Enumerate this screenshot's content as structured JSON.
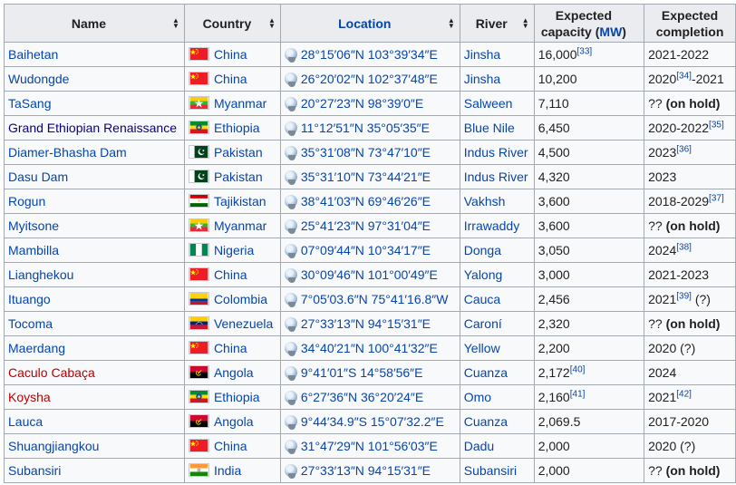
{
  "header": {
    "name": "Name",
    "country": "Country",
    "location": "Location",
    "river": "River",
    "capacity_pre": "Expected capacity (",
    "capacity_unit": "MW",
    "capacity_post": ")",
    "completion": "Expected completion"
  },
  "rows": [
    {
      "name": "Baihetan",
      "name_style": "link",
      "flag": "china",
      "country": "China",
      "coord": "28°15′06″N 103°39′34″E",
      "river": "Jinsha",
      "capacity": "16,000",
      "capacity_ref": "[33]",
      "completion": "2021-2022",
      "completion_ref": "",
      "completion_tail": "",
      "completion_bold": ""
    },
    {
      "name": "Wudongde",
      "name_style": "link",
      "flag": "china",
      "country": "China",
      "coord": "26°20′02″N 102°37′48″E",
      "river": "Jinsha",
      "capacity": "10,200",
      "capacity_ref": "",
      "completion": "2020",
      "completion_ref": "[34]",
      "completion_tail": "-2021",
      "completion_bold": ""
    },
    {
      "name": "TaSang",
      "name_style": "link",
      "flag": "myanmar",
      "country": "Myanmar",
      "coord": "20°27′23″N 98°39′0″E",
      "river": "Salween",
      "capacity": "7,110",
      "capacity_ref": "",
      "completion": "?? ",
      "completion_ref": "",
      "completion_tail": "",
      "completion_bold": "(on hold)"
    },
    {
      "name": "Grand Ethiopian Renaissance",
      "name_style": "dark",
      "flag": "ethiopia",
      "country": "Ethiopia",
      "coord": "11°12′51″N 35°05′35″E",
      "river": "Blue Nile",
      "capacity": "6,450",
      "capacity_ref": "",
      "completion": "2020-2022",
      "completion_ref": "[35]",
      "completion_tail": "",
      "completion_bold": ""
    },
    {
      "name": "Diamer-Bhasha Dam",
      "name_style": "link",
      "flag": "pakistan",
      "country": "Pakistan",
      "coord": "35°31′08″N 73°47′10″E",
      "river": "Indus River",
      "capacity": "4,500",
      "capacity_ref": "",
      "completion": "2023",
      "completion_ref": "[36]",
      "completion_tail": "",
      "completion_bold": ""
    },
    {
      "name": "Dasu Dam",
      "name_style": "link",
      "flag": "pakistan",
      "country": "Pakistan",
      "coord": "35°31′10″N 73°44′21″E",
      "river": "Indus River",
      "capacity": "4,320",
      "capacity_ref": "",
      "completion": "2023",
      "completion_ref": "",
      "completion_tail": "",
      "completion_bold": ""
    },
    {
      "name": "Rogun",
      "name_style": "link",
      "flag": "tajikistan",
      "country": "Tajikistan",
      "coord": "38°41′03″N 69°46′26″E",
      "river": "Vakhsh",
      "capacity": "3,600",
      "capacity_ref": "",
      "completion": "2018-2029",
      "completion_ref": "[37]",
      "completion_tail": "",
      "completion_bold": ""
    },
    {
      "name": "Myitsone",
      "name_style": "link",
      "flag": "myanmar",
      "country": "Myanmar",
      "coord": "25°41′23″N 97°31′04″E",
      "river": "Irrawaddy",
      "capacity": "3,600",
      "capacity_ref": "",
      "completion": "?? ",
      "completion_ref": "",
      "completion_tail": "",
      "completion_bold": "(on hold)"
    },
    {
      "name": "Mambilla",
      "name_style": "link",
      "flag": "nigeria",
      "country": "Nigeria",
      "coord": "07°09′44″N 10°34′17″E",
      "river": "Donga",
      "capacity": "3,050",
      "capacity_ref": "",
      "completion": "2024",
      "completion_ref": "[38]",
      "completion_tail": "",
      "completion_bold": ""
    },
    {
      "name": "Lianghekou",
      "name_style": "link",
      "flag": "china",
      "country": "China",
      "coord": "30°09′46″N 101°00′49″E",
      "river": "Yalong",
      "capacity": "3,000",
      "capacity_ref": "",
      "completion": "2021-2023",
      "completion_ref": "",
      "completion_tail": "",
      "completion_bold": ""
    },
    {
      "name": "Ituango",
      "name_style": "link",
      "flag": "colombia",
      "country": "Colombia",
      "coord": "7°05′03.6″N 75°41′16.8″W",
      "river": "Cauca",
      "capacity": "2,456",
      "capacity_ref": "",
      "completion": "2021",
      "completion_ref": "[39]",
      "completion_tail": " (?)",
      "completion_bold": ""
    },
    {
      "name": "Tocoma",
      "name_style": "link",
      "flag": "venezuela",
      "country": "Venezuela",
      "coord": "27°33′13″N 94°15′31″E",
      "river": "Caroní",
      "capacity": "2,320",
      "capacity_ref": "",
      "completion": "?? ",
      "completion_ref": "",
      "completion_tail": "",
      "completion_bold": "(on hold)"
    },
    {
      "name": "Maerdang",
      "name_style": "link",
      "flag": "china",
      "country": "China",
      "coord": "34°40′21″N 100°41′32″E",
      "river": "Yellow",
      "capacity": "2,200",
      "capacity_ref": "",
      "completion": "2020 (?)",
      "completion_ref": "",
      "completion_tail": "",
      "completion_bold": ""
    },
    {
      "name": "Caculo Cabaça",
      "name_style": "red",
      "flag": "angola",
      "country": "Angola",
      "coord": "9°41′01″S 14°58′56″E",
      "river": "Cuanza",
      "capacity": "2,172",
      "capacity_ref": "[40]",
      "completion": "2024",
      "completion_ref": "",
      "completion_tail": "",
      "completion_bold": ""
    },
    {
      "name": "Koysha",
      "name_style": "red",
      "flag": "ethiopia",
      "country": "Ethiopia",
      "coord": "6°27′36″N 36°20′24″E",
      "river": "Omo",
      "capacity": "2,160",
      "capacity_ref": "[41]",
      "completion": "2021",
      "completion_ref": "[42]",
      "completion_tail": "",
      "completion_bold": ""
    },
    {
      "name": "Lauca",
      "name_style": "link",
      "flag": "angola",
      "country": "Angola",
      "coord": "9°44′34.9″S 15°07′32.2″E",
      "river": "Cuanza",
      "capacity": "2,069.5",
      "capacity_ref": "",
      "completion": "2017-2020",
      "completion_ref": "",
      "completion_tail": "",
      "completion_bold": ""
    },
    {
      "name": "Shuangjiangkou",
      "name_style": "link",
      "flag": "china",
      "country": "China",
      "coord": "31°47′29″N 101°56′03″E",
      "river": "Dadu",
      "capacity": "2,000",
      "capacity_ref": "",
      "completion": "2020 (?)",
      "completion_ref": "",
      "completion_tail": "",
      "completion_bold": ""
    },
    {
      "name": "Subansiri",
      "name_style": "link",
      "flag": "india",
      "country": "India",
      "coord": "27°33′13″N 94°15′31″E",
      "river": "Subansiri",
      "capacity": "2,000",
      "capacity_ref": "",
      "completion": "?? ",
      "completion_ref": "",
      "completion_tail": "",
      "completion_bold": "(on hold)"
    }
  ]
}
